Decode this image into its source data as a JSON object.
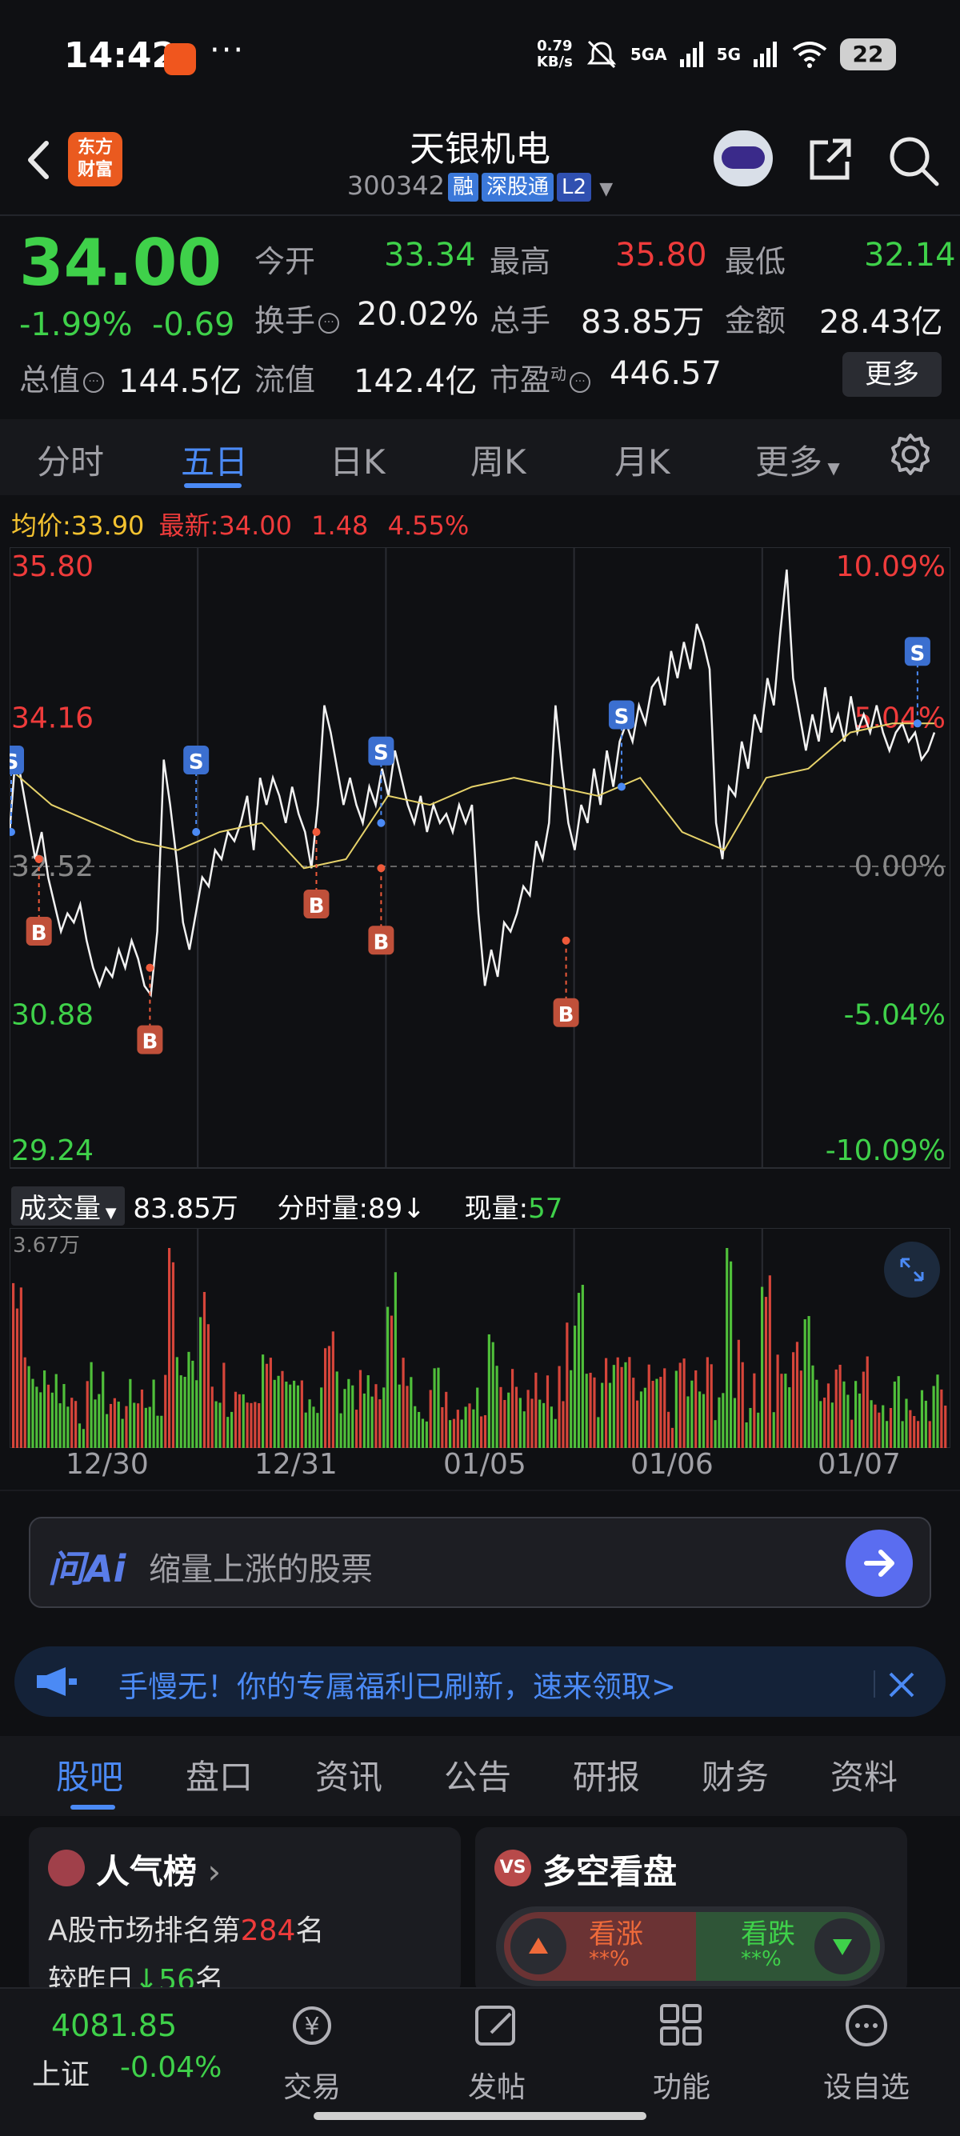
{
  "status_bar": {
    "time": "14:42",
    "net_speed_top": "0.79",
    "net_speed_bottom": "KB/s",
    "signal1": "5GA",
    "signal2": "5G",
    "battery": "22"
  },
  "header": {
    "logo_text_1": "东方",
    "logo_text_2": "财富",
    "name": "天银机电",
    "code": "300342",
    "tags": [
      "融",
      "深股通",
      "L2"
    ]
  },
  "quote": {
    "price": "34.00",
    "change_pct": "-1.99%",
    "change": "-0.69",
    "rows": [
      [
        {
          "label": "今开",
          "value": "33.34",
          "color": "green"
        },
        {
          "label": "最高",
          "value": "35.80",
          "color": "red"
        },
        {
          "label": "最低",
          "value": "32.14",
          "color": "green"
        }
      ],
      [
        {
          "label": "换手",
          "value": "20.02%",
          "color": "white"
        },
        {
          "label": "总手",
          "value": "83.85万",
          "color": "white"
        },
        {
          "label": "金额",
          "value": "28.43亿",
          "color": "white"
        }
      ],
      [
        {
          "label": "总值",
          "value": "144.5亿",
          "color": "white"
        },
        {
          "label": "流值",
          "value": "142.4亿",
          "color": "white"
        },
        {
          "label": "市盈",
          "value": "446.57",
          "color": "white",
          "sup": "动"
        }
      ]
    ],
    "more_label": "更多"
  },
  "tabs": [
    "分时",
    "五日",
    "日K",
    "周K",
    "月K",
    "更多"
  ],
  "active_tab": 1,
  "avg_info": {
    "avg_label": "均价:",
    "avg_value": "33.90",
    "latest_label": "最新:",
    "latest_value": "34.00",
    "diff": "1.48",
    "diff_pct": "4.55%"
  },
  "chart_data": {
    "type": "line",
    "title": "",
    "days": [
      "12/30",
      "12/31",
      "01/05",
      "01/06",
      "01/07"
    ],
    "y_left_ticks": [
      "35.80",
      "34.16",
      "32.52",
      "30.88",
      "29.24"
    ],
    "y_right_ticks": [
      "10.09%",
      "5.04%",
      "0.00%",
      "-5.04%",
      "-10.09%"
    ],
    "ylim": [
      29.24,
      35.8
    ],
    "base": 32.52,
    "series": [
      {
        "values": [
          32.9,
          33.8,
          33.4,
          33.0,
          32.6,
          32.9,
          32.4,
          32.1,
          31.8,
          32.0,
          31.9,
          32.1,
          31.7,
          31.4,
          31.2,
          31.4,
          31.3,
          31.6,
          31.4,
          31.7,
          31.5,
          31.2,
          31.1,
          31.8,
          33.7,
          33.2,
          32.6,
          31.9,
          31.6,
          32.0,
          32.4,
          32.3,
          32.7,
          32.6,
          32.9,
          32.8,
          33.0,
          33.3,
          32.7,
          33.5,
          33.2,
          33.5,
          33.3,
          33.0,
          33.4,
          33.1,
          32.9,
          32.5,
          33.2,
          34.3,
          34.0,
          33.6,
          33.2,
          33.5,
          33.2,
          33.0,
          33.4,
          33.2,
          33.6,
          33.3,
          33.8,
          33.5,
          33.2,
          33.0,
          33.3,
          32.9,
          33.2,
          33.0,
          33.1,
          32.9,
          33.2,
          33.0,
          33.2,
          32.0,
          31.2,
          31.6,
          31.3,
          31.9,
          31.8,
          32.0,
          32.3,
          32.2,
          32.8,
          32.6,
          33.0,
          34.3,
          33.6,
          33.0,
          32.7,
          33.2,
          33.0,
          33.6,
          33.2,
          33.8,
          33.4,
          33.9,
          34.1,
          33.9,
          34.3,
          34.1,
          34.5,
          34.6,
          34.3,
          34.9,
          34.6,
          35.0,
          34.7,
          35.2,
          35.0,
          34.7,
          33.0,
          32.6,
          33.4,
          33.3,
          33.9,
          33.6,
          34.2,
          34.0,
          34.6,
          34.3,
          35.1,
          35.8,
          34.6,
          34.2,
          33.8,
          34.2,
          33.9,
          34.5,
          34.0,
          34.2,
          33.9,
          34.4,
          34.0,
          34.2,
          34.0,
          34.3,
          34.0,
          33.8,
          34.0,
          34.1,
          33.9,
          34.0,
          33.7,
          33.8,
          34.0
        ]
      },
      {
        "values": [
          33.6,
          33.2,
          33.0,
          32.8,
          32.7,
          32.9,
          33.0,
          32.5,
          32.6,
          33.3,
          33.2,
          33.4,
          33.5,
          33.4,
          33.3,
          33.5,
          32.9,
          32.7,
          33.5,
          33.6,
          34.0,
          34.1,
          34.1
        ]
      }
    ],
    "markers": [
      {
        "kind": "S",
        "day_pos": 0.0,
        "price": 32.9
      },
      {
        "kind": "B",
        "day_pos": 0.03,
        "price": 32.6
      },
      {
        "kind": "B",
        "day_pos": 0.15,
        "price": 31.4
      },
      {
        "kind": "S",
        "day_pos": 0.2,
        "price": 32.9
      },
      {
        "kind": "B",
        "day_pos": 0.33,
        "price": 32.9
      },
      {
        "kind": "S",
        "day_pos": 0.4,
        "price": 33.0
      },
      {
        "kind": "B",
        "day_pos": 0.4,
        "price": 32.5
      },
      {
        "kind": "B",
        "day_pos": 0.6,
        "price": 31.7
      },
      {
        "kind": "S",
        "day_pos": 0.66,
        "price": 33.4
      },
      {
        "kind": "S",
        "day_pos": 0.98,
        "price": 34.1
      }
    ],
    "colors": {
      "up": "#ef3b3b",
      "down": "#3fd14a",
      "price_line": "#f2f2f2",
      "avg_line": "#e6d26a",
      "grid": "#2a2c32"
    }
  },
  "volume": {
    "label": "成交量",
    "total": "83.85万",
    "tick_label": "分时量:",
    "tick_value": "89",
    "tick_arrow": "↓",
    "now_label": "现量:",
    "now_value": "57",
    "max_label": "3.67万"
  },
  "ai": {
    "logo": "问Ai",
    "placeholder": "缩量上涨的股票"
  },
  "banner": {
    "text": "手慢无！你的专属福利已刷新，速来领取>"
  },
  "bottom_tabs": [
    "股吧",
    "盘口",
    "资讯",
    "公告",
    "研报",
    "财务",
    "资料"
  ],
  "cards": {
    "popularity": {
      "title": "人气榜",
      "line1_prefix": "A股市场排名第",
      "rank": "284",
      "line1_suffix": "名",
      "line2_prefix": "较昨日",
      "delta": "56",
      "line2_suffix": "名"
    },
    "bull_bear": {
      "title": "多空看盘",
      "bull_label": "看涨",
      "bull_value": "**%",
      "bear_label": "看跌",
      "bear_value": "**%"
    }
  },
  "bottom_nav": {
    "index_value": "4081.85",
    "index_name": "上证",
    "index_change": "-0.04%",
    "items": [
      "交易",
      "发帖",
      "功能",
      "设自选"
    ]
  }
}
